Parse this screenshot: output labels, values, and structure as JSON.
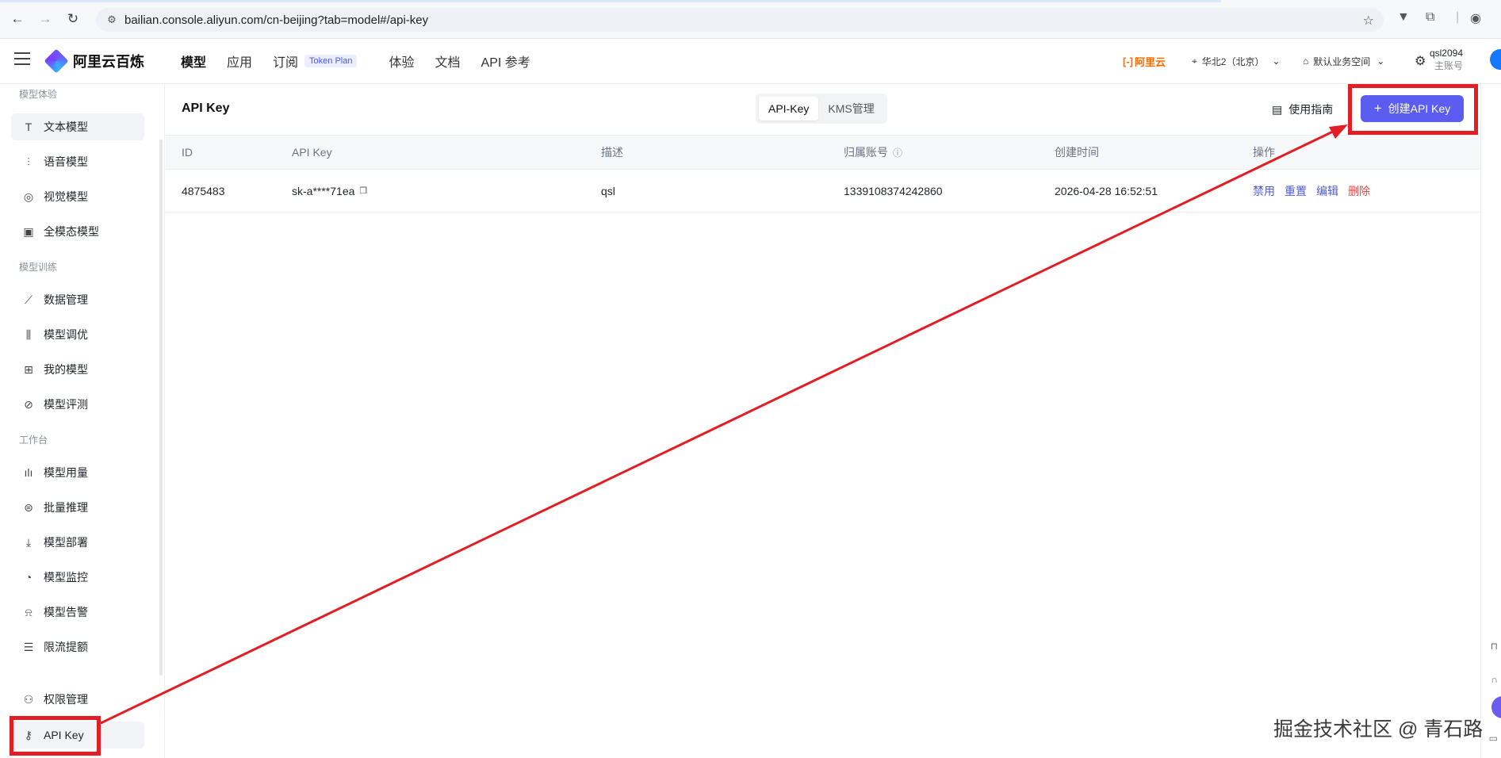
{
  "browser": {
    "url": "bailian.console.aliyun.com/cn-beijing?tab=model#/api-key"
  },
  "header": {
    "logo_text": "阿里云百炼",
    "nav": [
      {
        "label": "模型",
        "active": true
      },
      {
        "label": "应用"
      },
      {
        "label": "订阅",
        "badge": "Token Plan"
      },
      {
        "label": "体验"
      },
      {
        "label": "文档"
      },
      {
        "label": "API 参考"
      }
    ],
    "aliyun_label": "阿里云",
    "region": "华北2（北京）",
    "workspace": "默认业务空间",
    "user_name": "qsl2094",
    "user_role": "主账号"
  },
  "sidebar": {
    "groups": [
      {
        "label": "模型体验",
        "items": [
          {
            "label": "文本模型",
            "icon": "text-icon",
            "active": true
          },
          {
            "label": "语音模型",
            "icon": "waveform-icon"
          },
          {
            "label": "视觉模型",
            "icon": "camera-icon"
          },
          {
            "label": "全模态模型",
            "icon": "media-icon"
          }
        ]
      },
      {
        "label": "模型训练",
        "items": [
          {
            "label": "数据管理",
            "icon": "chart-icon"
          },
          {
            "label": "模型调优",
            "icon": "sliders-icon"
          },
          {
            "label": "我的模型",
            "icon": "grid-icon"
          },
          {
            "label": "模型评测",
            "icon": "compass-icon"
          }
        ]
      },
      {
        "label": "工作台",
        "items": [
          {
            "label": "模型用量",
            "icon": "bar-chart-icon"
          },
          {
            "label": "批量推理",
            "icon": "batch-icon"
          },
          {
            "label": "模型部署",
            "icon": "download-icon"
          },
          {
            "label": "模型监控",
            "icon": "pie-icon"
          },
          {
            "label": "模型告警",
            "icon": "alarm-icon"
          },
          {
            "label": "限流提额",
            "icon": "database-icon"
          }
        ]
      }
    ],
    "bottom_items": [
      {
        "label": "权限管理",
        "icon": "user-icon"
      },
      {
        "label": "API Key",
        "icon": "key-icon",
        "active": true
      }
    ]
  },
  "main": {
    "title": "API Key",
    "segments": [
      {
        "label": "API-Key",
        "active": true
      },
      {
        "label": "KMS管理"
      }
    ],
    "guide_label": "使用指南",
    "create_button": "创建API Key",
    "table": {
      "columns": [
        "ID",
        "API Key",
        "描述",
        "归属账号",
        "创建时间",
        "操作"
      ],
      "rows": [
        {
          "id": "4875483",
          "api_key": "sk-a****71ea",
          "description": "qsl",
          "account": "1339108374242860",
          "created": "2026-04-28 16:52:51",
          "actions": [
            "禁用",
            "重置",
            "编辑",
            "删除"
          ]
        }
      ]
    }
  },
  "watermark": "掘金技术社区 @ 青石路",
  "colors": {
    "primary": "#5b5cf0",
    "annotation_red": "#e01e24",
    "danger": "#ef4444",
    "brand_orange": "#ff6a00"
  }
}
